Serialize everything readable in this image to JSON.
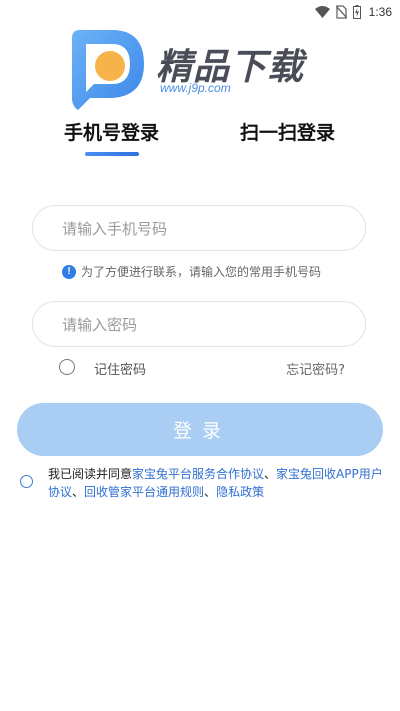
{
  "status_bar": {
    "time": "1:36"
  },
  "logo": {
    "brand": "精品下载",
    "url": "www.j9p.com"
  },
  "tabs": [
    {
      "label": "手机号登录",
      "active": true
    },
    {
      "label": "扫一扫登录",
      "active": false
    }
  ],
  "form": {
    "phone_placeholder": "请输入手机号码",
    "phone_hint": "为了方便进行联系，请输入您的常用手机号码",
    "password_placeholder": "请输入密码",
    "remember_label": "记住密码",
    "forgot_label": "忘记密码?",
    "login_button": "登录"
  },
  "agreement": {
    "prefix": "我已阅读并同意",
    "links": [
      "家宝兔平台服务合作协议",
      "家宝兔回收APP用户协议",
      "回收管家平台通用规则",
      "隐私政策"
    ],
    "separator": "、"
  },
  "colors": {
    "accent": "#2f7ce6",
    "login_button_disabled": "#a9cdf3",
    "link": "#2f6fd0"
  }
}
